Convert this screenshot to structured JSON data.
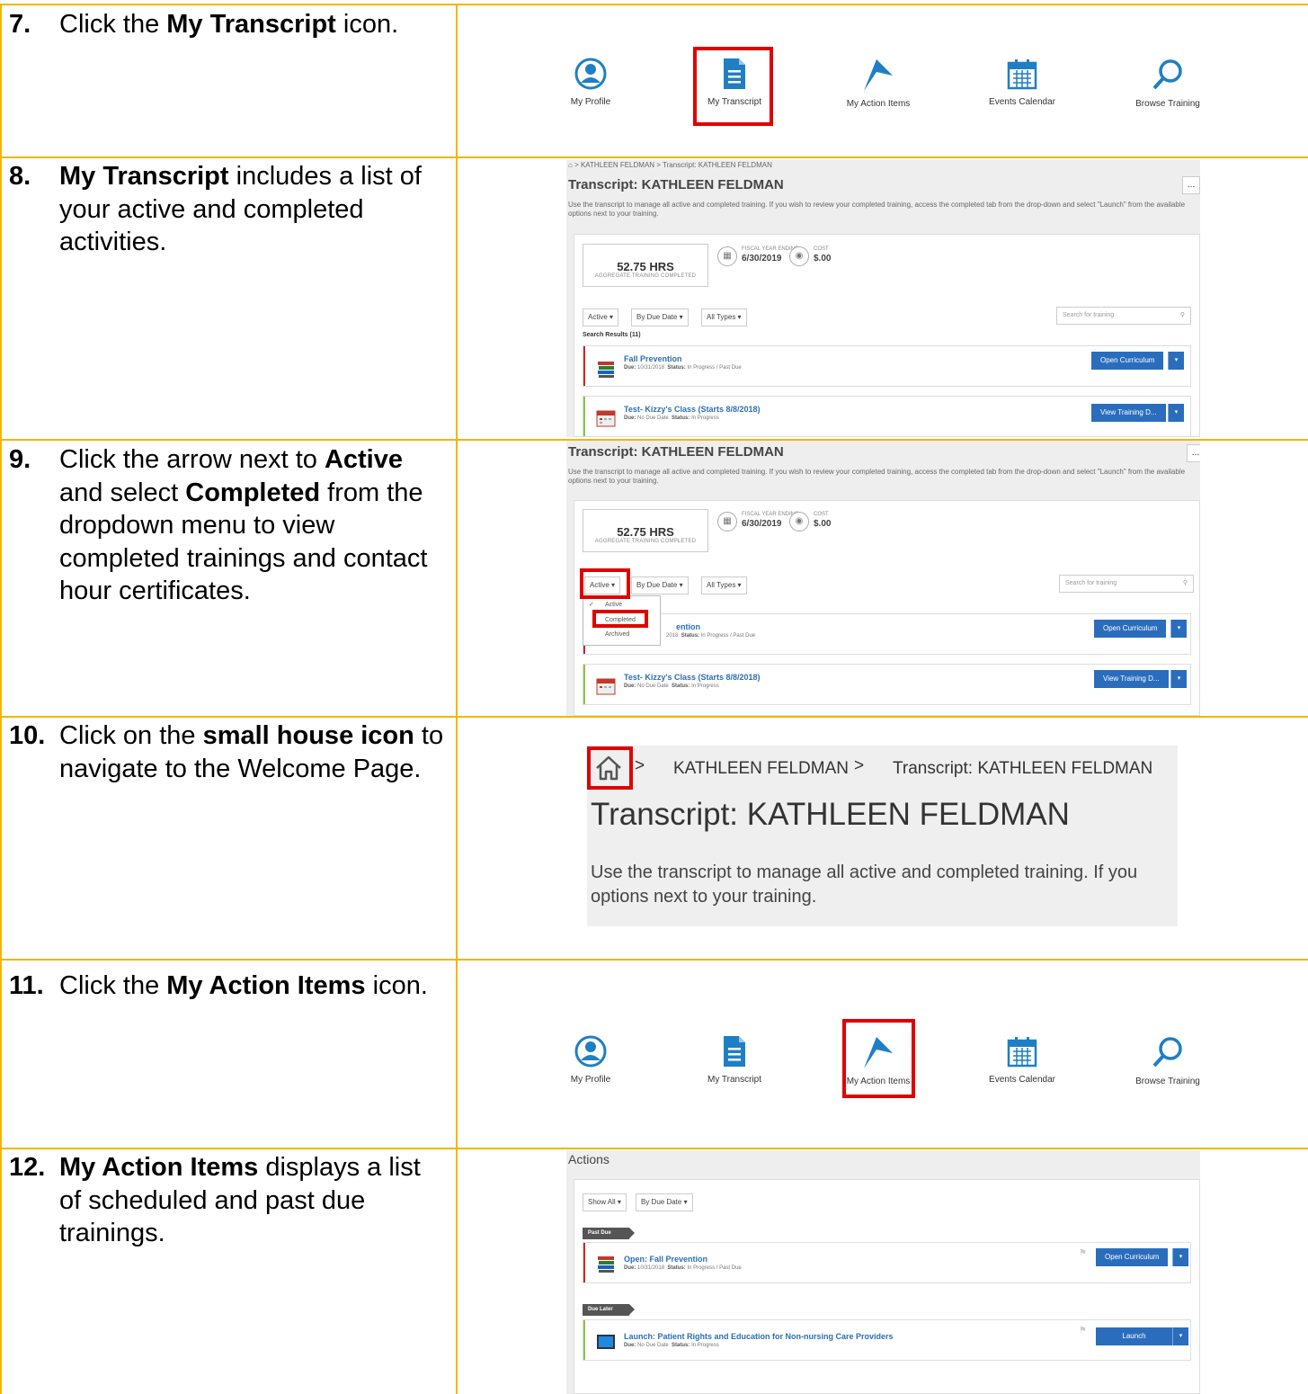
{
  "steps": [
    {
      "num": "7.",
      "pre": "Click the ",
      "b1": "My Transcript",
      "mid": " icon.",
      "b2": "",
      "post": ""
    },
    {
      "num": "8.",
      "pre": "",
      "b1": "My Transcript",
      "mid": " includes a list of your active and completed activities.",
      "b2": "",
      "post": ""
    },
    {
      "num": "9.",
      "pre": "Click the arrow next to ",
      "b1": "Active",
      "mid": " and select ",
      "b2": "Completed",
      "post": " from the dropdown menu to view completed trainings and contact hour certificates."
    },
    {
      "num": "10.",
      "pre": "Click on the ",
      "b1": "small house icon",
      "mid": " to navigate to the Welcome Page.",
      "b2": "",
      "post": ""
    },
    {
      "num": "11.",
      "pre": "Click the ",
      "b1": "My Action Items",
      "mid": " icon.",
      "b2": "",
      "post": ""
    },
    {
      "num": "12.",
      "pre": "",
      "b1": "My Action Items",
      "mid": " displays a list of scheduled and past due trainings.",
      "b2": "",
      "post": ""
    }
  ],
  "icons": {
    "profile": "My Profile",
    "transcript": "My Transcript",
    "action_items": "My Action Items",
    "events": "Events Calendar",
    "browse": "Browse Training"
  },
  "transcript": {
    "crumb_user": "KATHLEEN FELDMAN",
    "crumb_page": "Transcript: KATHLEEN FELDMAN",
    "title": "Transcript: KATHLEEN FELDMAN",
    "desc_line1": "Use the transcript to manage all active and completed training. If you wish to review your completed training, access the completed tab from the drop-down and select \"Launch\" from the available",
    "desc_line2": "options next to your training.",
    "hrs": "52.75 HRS",
    "hrs_label": "AGGREGATE TRAINING COMPLETED",
    "fiscal_label": "FISCAL YEAR ENDING",
    "fiscal_value": "6/30/2019",
    "cost_label": "COST",
    "cost_value": "$.00",
    "filter_status": "Active",
    "filter_date": "By Due Date",
    "filter_types": "All Types",
    "search_placeholder": "Search for training",
    "results": "Search Results (11)",
    "row1_title": "Fall Prevention",
    "row1_due_label": "Due:",
    "row1_due": "10/31/2018",
    "row1_status_label": "Status:",
    "row1_status": "In Progress / Past Due",
    "row1_button": "Open Curriculum",
    "row2_title": "Test- Kizzy's Class (Starts 8/8/2018)",
    "row2_due_label": "Due:",
    "row2_due": "No Due Date",
    "row2_status_label": "Status:",
    "row2_status": "In Progress",
    "row2_button": "View Training D...",
    "dd_active": "Active",
    "dd_completed": "Completed",
    "dd_archived": "Archived",
    "row1_title_partial": "ention",
    "row1_due_partial": "2018"
  },
  "zoom": {
    "crumb_user": "KATHLEEN FELDMAN",
    "crumb_page": "Transcript: KATHLEEN FELDMAN",
    "title": "Transcript: KATHLEEN FELDMAN",
    "desc_line1": "Use the transcript to manage all active and completed training. If you",
    "desc_line2": "options next to your training."
  },
  "actions": {
    "title": "Actions",
    "filter_show": "Show All",
    "filter_date": "By Due Date",
    "band_past_due": "Past Due",
    "band_due_later": "Due Later",
    "row1_title": "Open: Fall Prevention",
    "row1_due_label": "Due:",
    "row1_due": "10/31/2018",
    "row1_status_label": "Status:",
    "row1_status": "In Progress / Past Due",
    "row1_button": "Open Curriculum",
    "row2_title": "Launch: Patient Rights and Education for Non-nursing Care Providers",
    "row2_due_label": "Due:",
    "row2_due": "No Due Date",
    "row2_status_label": "Status:",
    "row2_status": "In Progress",
    "row2_button": "Launch"
  },
  "colors": {
    "table_border": "#f2b600",
    "highlight": "#e00000",
    "icon_blue": "#1f7fc4",
    "button_blue": "#2a6dbd",
    "link_blue": "#2c6fb2"
  }
}
